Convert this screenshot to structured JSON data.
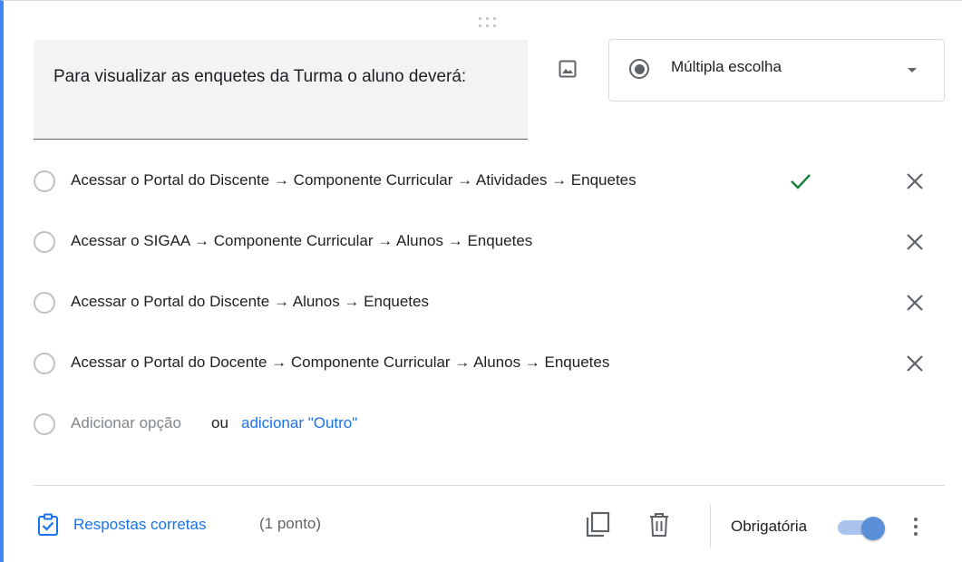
{
  "question": {
    "title": "Para visualizar as enquetes da Turma o aluno deverá:"
  },
  "question_type": {
    "selected": "Múltipla escolha",
    "icon": "radio-button-checked-icon"
  },
  "options": [
    {
      "label": "Acessar o Portal do Discente → Componente Curricular → Atividades → Enquetes",
      "correct": true
    },
    {
      "label": "Acessar o SIGAA → Componente Curricular → Alunos → Enquetes",
      "correct": false
    },
    {
      "label": "Acessar o Portal do Discente → Alunos → Enquetes",
      "correct": false
    },
    {
      "label": "Acessar o Portal do Docente → Componente Curricular → Alunos → Enquetes",
      "correct": false
    }
  ],
  "add_option": {
    "placeholder": "Adicionar opção",
    "or_text": "ou",
    "other_link": "adicionar \"Outro\""
  },
  "footer": {
    "answer_key_label": "Respostas corretas",
    "points_label": "(1 ponto)",
    "required_label": "Obrigatória",
    "required_on": true
  },
  "colors": {
    "accent": "#1a73e8",
    "correct_check": "#188038",
    "card_left_border": "#4285f4"
  }
}
